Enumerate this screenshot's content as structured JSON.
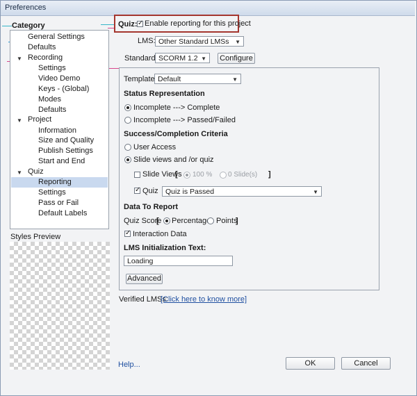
{
  "window": {
    "title": "Preferences"
  },
  "category": {
    "heading": "Category",
    "items": [
      {
        "label": "General Settings"
      },
      {
        "label": "Defaults"
      },
      {
        "label": "Recording"
      },
      {
        "label": "Settings"
      },
      {
        "label": "Video Demo"
      },
      {
        "label": "Keys - (Global)"
      },
      {
        "label": "Modes"
      },
      {
        "label": "Defaults"
      },
      {
        "label": "Project"
      },
      {
        "label": "Information"
      },
      {
        "label": "Size and Quality"
      },
      {
        "label": "Publish Settings"
      },
      {
        "label": "Start and End"
      },
      {
        "label": "Quiz"
      },
      {
        "label": "Reporting"
      },
      {
        "label": "Settings"
      },
      {
        "label": "Pass or Fail"
      },
      {
        "label": "Default Labels"
      }
    ],
    "selected": "Reporting"
  },
  "styles_preview": {
    "label": "Styles Preview"
  },
  "quiz": {
    "label": "Quiz:",
    "enable_label": "Enable reporting for this project",
    "enabled": true
  },
  "lms": {
    "label": "LMS:",
    "value": "Other Standard LMSs"
  },
  "standard": {
    "label": "Standard:",
    "value": "SCORM 1.2",
    "configure_label": "Configure"
  },
  "template": {
    "label": "Template:",
    "value": "Default"
  },
  "status": {
    "heading": "Status Representation",
    "option1": "Incomplete ---> Complete",
    "option2": "Incomplete ---> Passed/Failed"
  },
  "criteria": {
    "heading": "Success/Completion Criteria",
    "user_access": "User Access",
    "slide_views_quiz": "Slide views and /or quiz",
    "slide_views_label": "Slide Views",
    "bracket_open": "[",
    "bracket_close": "]",
    "percent_option": "100 %",
    "slides_option": "0 Slide(s)",
    "quiz_label": "Quiz",
    "quiz_value": "Quiz is Passed"
  },
  "data_to_report": {
    "heading": "Data To Report",
    "quiz_score_label": "Quiz Score",
    "bracket_open": "[",
    "bracket_close": "]",
    "percentage": "Percentage",
    "points": "Points",
    "interaction_data": "Interaction Data"
  },
  "lms_init": {
    "heading": "LMS Initialization Text:",
    "value": "Loading"
  },
  "advanced_label": "Advanced",
  "verified": {
    "label": "Verified LMSs:",
    "link": "[Click here to know more]"
  },
  "help_link": "Help...",
  "ok_label": "OK",
  "cancel_label": "Cancel",
  "colors": {
    "selection": "#c9d9ef",
    "highlight_box": "#a4352e",
    "link": "#1f4fa0"
  }
}
